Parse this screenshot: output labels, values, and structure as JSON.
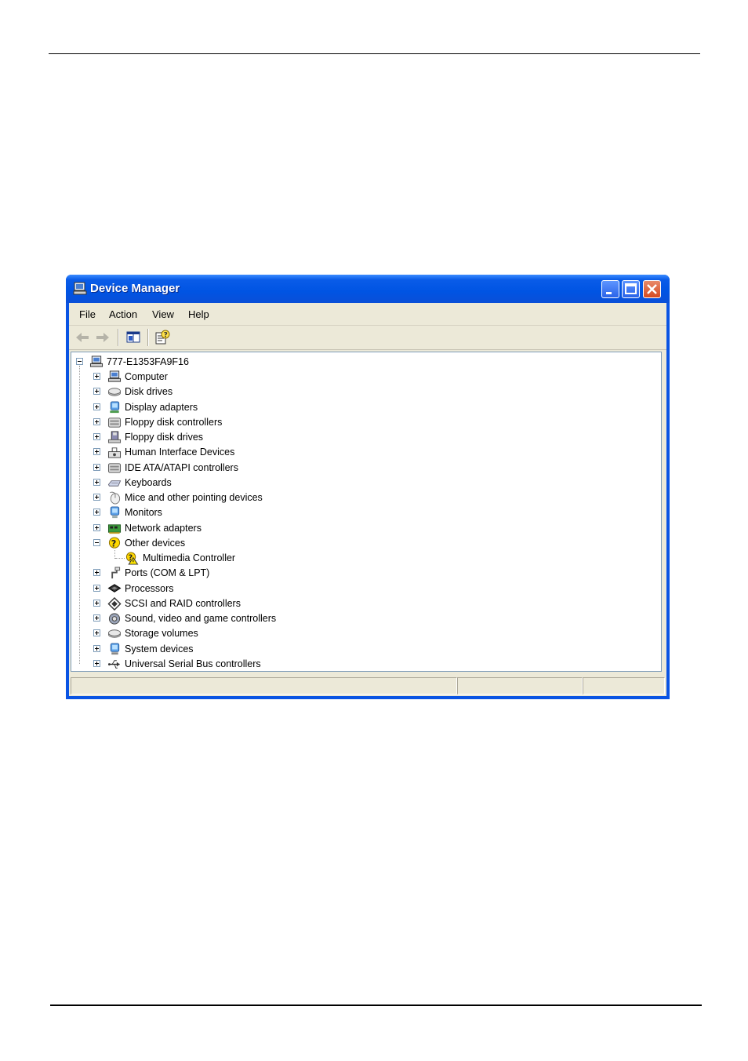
{
  "window": {
    "title": "Device Manager",
    "menu": [
      "File",
      "Action",
      "View",
      "Help"
    ]
  },
  "tree": {
    "root": "777-E1353FA9F16",
    "categories": [
      {
        "label": "Computer",
        "icon": "computer-icon"
      },
      {
        "label": "Disk drives",
        "icon": "disk-drive-icon"
      },
      {
        "label": "Display adapters",
        "icon": "display-adapter-icon"
      },
      {
        "label": "Floppy disk controllers",
        "icon": "floppy-controller-icon"
      },
      {
        "label": "Floppy disk drives",
        "icon": "floppy-drive-icon"
      },
      {
        "label": "Human Interface Devices",
        "icon": "hid-icon"
      },
      {
        "label": "IDE ATA/ATAPI controllers",
        "icon": "ide-controller-icon"
      },
      {
        "label": "Keyboards",
        "icon": "keyboard-icon"
      },
      {
        "label": "Mice and other pointing devices",
        "icon": "mouse-icon"
      },
      {
        "label": "Monitors",
        "icon": "monitor-icon"
      },
      {
        "label": "Network adapters",
        "icon": "network-adapter-icon"
      },
      {
        "label": "Other devices",
        "icon": "unknown-device-icon",
        "expanded": true,
        "children": [
          {
            "label": "Multimedia Controller",
            "icon": "warning-device-icon"
          }
        ]
      },
      {
        "label": "Ports (COM & LPT)",
        "icon": "port-icon"
      },
      {
        "label": "Processors",
        "icon": "processor-icon"
      },
      {
        "label": "SCSI and RAID controllers",
        "icon": "scsi-icon"
      },
      {
        "label": "Sound, video and game controllers",
        "icon": "sound-icon"
      },
      {
        "label": "Storage volumes",
        "icon": "storage-volume-icon"
      },
      {
        "label": "System devices",
        "icon": "system-device-icon"
      },
      {
        "label": "Universal Serial Bus controllers",
        "icon": "usb-icon"
      }
    ]
  }
}
